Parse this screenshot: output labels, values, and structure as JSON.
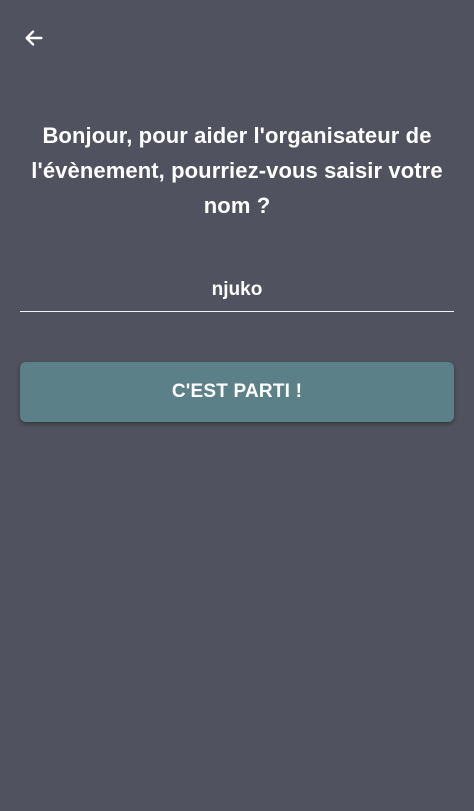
{
  "header": {
    "back_icon": "arrow-left-icon"
  },
  "prompt": {
    "text": "Bonjour, pour aider l'organisateur de l'évènement, pourriez-vous saisir votre nom ?"
  },
  "name_field": {
    "value": "njuko",
    "placeholder": ""
  },
  "submit": {
    "label": "C'EST PARTI !"
  },
  "colors": {
    "background": "#50535f",
    "button": "#5b8088",
    "text": "#ffffff",
    "underline": "#f2f2f2"
  }
}
